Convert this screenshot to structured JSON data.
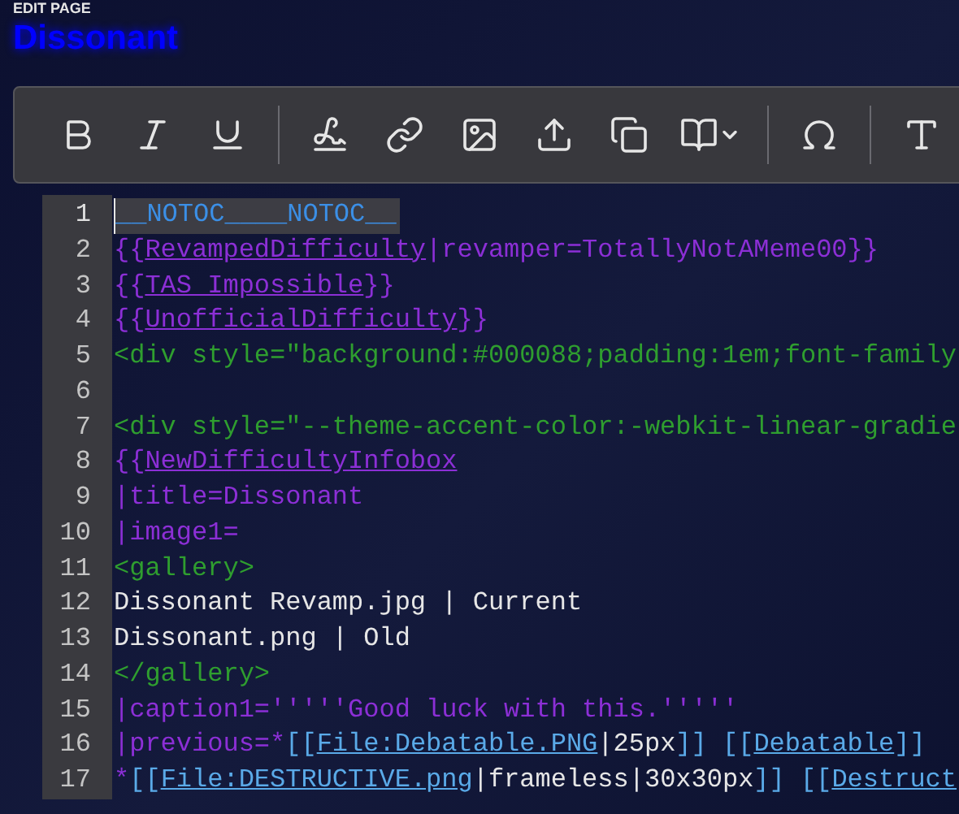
{
  "header": {
    "label": "EDIT PAGE",
    "title": "Dissonant"
  },
  "toolbar": [
    {
      "kind": "bold"
    },
    {
      "kind": "italic"
    },
    {
      "kind": "underline"
    },
    {
      "kind": "divider"
    },
    {
      "kind": "signature"
    },
    {
      "kind": "link"
    },
    {
      "kind": "image"
    },
    {
      "kind": "upload"
    },
    {
      "kind": "gallery"
    },
    {
      "kind": "book"
    },
    {
      "kind": "divider"
    },
    {
      "kind": "omega"
    },
    {
      "kind": "divider"
    },
    {
      "kind": "text"
    }
  ],
  "editor": {
    "lines": [
      {
        "number": "1",
        "highlighted": true,
        "segments": [
          {
            "text": "__NOTOC____NOTOC__",
            "kind": "magic"
          }
        ]
      },
      {
        "number": "2",
        "highlighted": false,
        "segments": [
          {
            "text": "{{",
            "kind": "template"
          },
          {
            "text": "RevampedDifficulty",
            "kind": "template-link"
          },
          {
            "text": "|revamper=TotallyNotAMeme00}}",
            "kind": "template"
          }
        ]
      },
      {
        "number": "3",
        "highlighted": false,
        "segments": [
          {
            "text": "{{",
            "kind": "template"
          },
          {
            "text": "TAS Impossible",
            "kind": "template-link"
          },
          {
            "text": "}}",
            "kind": "template"
          }
        ]
      },
      {
        "number": "4",
        "highlighted": false,
        "segments": [
          {
            "text": "{{",
            "kind": "template"
          },
          {
            "text": "UnofficialDifficulty",
            "kind": "template-link"
          },
          {
            "text": "}}",
            "kind": "template"
          }
        ]
      },
      {
        "number": "5",
        "highlighted": false,
        "segments": [
          {
            "text": "<div style=\"background:#000088;padding:1em;font-family",
            "kind": "tag"
          }
        ]
      },
      {
        "number": "6",
        "highlighted": false
      },
      {
        "number": "7",
        "highlighted": false,
        "segments": [
          {
            "text": "<div style=\"--theme-accent-color:-webkit-linear-gradie",
            "kind": "tag"
          }
        ]
      },
      {
        "number": "8",
        "highlighted": false,
        "segments": [
          {
            "text": "{{",
            "kind": "template"
          },
          {
            "text": "NewDifficultyInfobox",
            "kind": "template-link"
          }
        ]
      },
      {
        "number": "9",
        "highlighted": false,
        "segments": [
          {
            "text": "|title=Dissonant",
            "kind": "template"
          }
        ]
      },
      {
        "number": "10",
        "highlighted": false,
        "segments": [
          {
            "text": "|image1=",
            "kind": "template"
          }
        ]
      },
      {
        "number": "11",
        "highlighted": false,
        "segments": [
          {
            "text": "<gallery>",
            "kind": "tag"
          }
        ]
      },
      {
        "number": "12",
        "highlighted": false,
        "segments": [
          {
            "text": "Dissonant Revamp.jpg | Current",
            "kind": "plain"
          }
        ]
      },
      {
        "number": "13",
        "highlighted": false,
        "segments": [
          {
            "text": "Dissonant.png | Old",
            "kind": "plain"
          }
        ]
      },
      {
        "number": "14",
        "highlighted": false,
        "segments": [
          {
            "text": "</gallery>",
            "kind": "tag"
          }
        ]
      },
      {
        "number": "15",
        "highlighted": false,
        "segments": [
          {
            "text": "|caption1='''''Good luck with this.'''''",
            "kind": "template"
          }
        ]
      },
      {
        "number": "16",
        "highlighted": false,
        "segments": [
          {
            "text": "|previous=*",
            "kind": "template"
          },
          {
            "text": "[[",
            "kind": "wiki"
          },
          {
            "text": "File:Debatable.PNG",
            "kind": "wiki-link"
          },
          {
            "text": "|25px",
            "kind": "plain"
          },
          {
            "text": "]] [[",
            "kind": "wiki"
          },
          {
            "text": "Debatable",
            "kind": "wiki-link"
          },
          {
            "text": "]]",
            "kind": "wiki"
          }
        ]
      },
      {
        "number": "17",
        "highlighted": false,
        "segments": [
          {
            "text": "*",
            "kind": "template"
          },
          {
            "text": "[[",
            "kind": "wiki"
          },
          {
            "text": "File:DESTRUCTIVE.png",
            "kind": "wiki-link"
          },
          {
            "text": "|frameless|30x30px",
            "kind": "plain"
          },
          {
            "text": "]] [[",
            "kind": "wiki"
          },
          {
            "text": "Destruct",
            "kind": "wiki-link"
          }
        ]
      }
    ]
  }
}
